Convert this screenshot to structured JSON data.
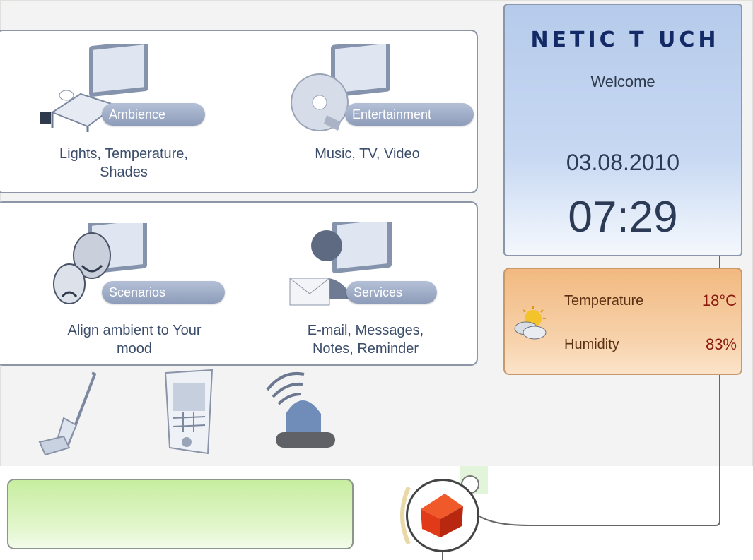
{
  "tiles": [
    {
      "pill": "Ambience",
      "label_lines": [
        "Lights, Temperature,",
        "Shades"
      ],
      "icon": "bed-tv-icon"
    },
    {
      "pill": "Entertainment",
      "label_lines": [
        "Music, TV, Video"
      ],
      "icon": "disc-tv-icon"
    },
    {
      "pill": "Scenarios",
      "label_lines": [
        "Align ambient to Your",
        "mood"
      ],
      "icon": "theater-masks-icon"
    },
    {
      "pill": "Services",
      "label_lines": [
        "E-mail, Messages,",
        "Notes, Reminder"
      ],
      "icon": "person-mail-icon"
    }
  ],
  "quick_icons": [
    "vacuum-cleaner-icon",
    "intercom-panel-icon",
    "alarm-siren-icon"
  ],
  "info": {
    "logo": "NETIC T UCH",
    "welcome": "Welcome",
    "date": "03.08.2010",
    "time": "07:29"
  },
  "weather": {
    "icon": "sun-cloud-icon",
    "temperature_label": "Temperature",
    "temperature_value": "18°C",
    "humidity_label": "Humidity",
    "humidity_value": "83%"
  },
  "home_button": {
    "icon": "red-house-icon"
  },
  "colors": {
    "info_blue": "#b6cbeb",
    "weather_orange": "#f2b980",
    "status_green": "#c7eea0",
    "pill": "#8d9cba",
    "house_red": "#e8321a"
  }
}
